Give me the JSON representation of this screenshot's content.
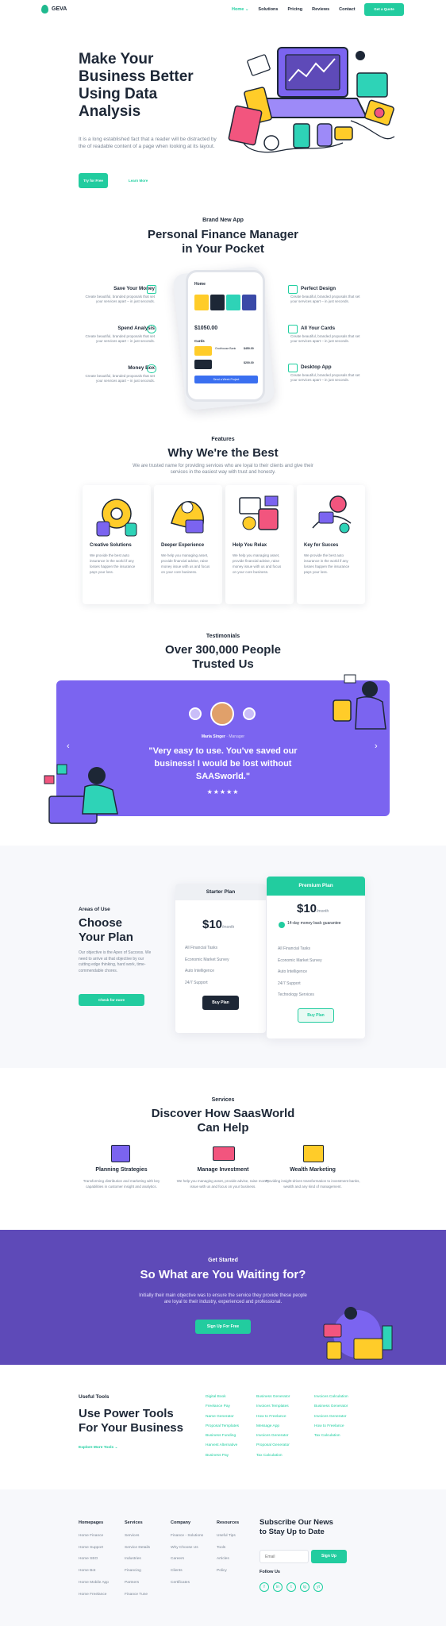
{
  "header": {
    "brand": "GEVA",
    "nav": [
      "Home",
      "Solutions",
      "Pricing",
      "Reviews",
      "Contact"
    ],
    "nav_home_caret": "⌄",
    "quote_button": "Get a Quote"
  },
  "hero": {
    "title_lines": [
      "Make Your",
      "Business Better",
      "Using Data",
      "Analysis"
    ],
    "text": "It is a long established fact that a reader will be distracted by the of readable content of a page when looking at its layout.",
    "primary_button": "Try for Free",
    "secondary_link": "Learn More"
  },
  "app": {
    "kicker": "Brand New App",
    "title_lines": [
      "Personal Finance Manager",
      "in Your Pocket"
    ],
    "left_features": [
      {
        "title": "Save Your Money",
        "text": "Create beautiful, branded proposals that set your services apart – in just seconds.",
        "icon": "wallet-icon"
      },
      {
        "title": "Spend Analysis",
        "text": "Create beautiful, branded proposals that set your services apart – in just seconds.",
        "icon": "chart-pie-icon"
      },
      {
        "title": "Money Box",
        "text": "Create beautiful, branded proposals that set your services apart – in just seconds.",
        "icon": "piggy-bank-icon"
      }
    ],
    "right_features": [
      {
        "title": "Perfect Design",
        "text": "Create beautiful, branded proposals that set your services apart – in just seconds.",
        "icon": "diamond-icon"
      },
      {
        "title": "All Your Cards",
        "text": "Create beautiful, branded proposals that set your services apart – in just seconds.",
        "icon": "credit-card-icon"
      },
      {
        "title": "Desktop App",
        "text": "Create beautiful, branded proposals that set your services apart – in just seconds.",
        "icon": "monitor-icon"
      }
    ],
    "phone": {
      "home": "Home",
      "amount": "$1050.00",
      "cards_label": "Cards",
      "card_name": "Grubhouse Bank",
      "card_amount": "$450.00",
      "card_amount_2": "$200.00",
      "button": "Send a Week Project"
    }
  },
  "features": {
    "kicker": "Features",
    "title": "Why We're the Best",
    "subtitle": "We are trusted name for providing services who are loyal to their clients and give their services in the easiest way with trust and honesty.",
    "cards": [
      {
        "title": "Creative Solutions",
        "text": "We provide the best auto insurance in the world if any losses happen the insurance pays your loss."
      },
      {
        "title": "Deeper Experience",
        "text": "We help you managing asset, provide financial advise, raise money issue with us and focus on your core business."
      },
      {
        "title": "Help You Relax",
        "text": "We help you managing asset, provide financial advise, raise money issue with us and focus on your core business."
      },
      {
        "title": "Key for Succes",
        "text": "We provide the best auto insurance in the world if any losses happen the insurance pays your loss."
      }
    ]
  },
  "testimonials": {
    "kicker": "Testimonials",
    "title_lines": [
      "Over 300,000 People",
      "Trusted Us"
    ],
    "author": "Maria Singer",
    "role": "· Manager",
    "quote": "\"Very easy to use. You've saved our business! I would be lost without SAASworld.\"",
    "rating": 5,
    "stars": "★★★★★",
    "prev_arrow": "‹",
    "next_arrow": "›"
  },
  "pricing": {
    "kicker": "Areas of Use",
    "title_lines": [
      "Choose",
      "Your Plan"
    ],
    "text": "Our objective is the Apex of Success. We need to arrive at that objective by our cutting edge thinking, hard work, time-commendable chores.",
    "button": "Check for more",
    "starter": {
      "name": "Starter Plan",
      "price": "$10",
      "period": "/month",
      "features": [
        "All Financial Tasks",
        "Economic Market Survey",
        "Auto Intelligence",
        "24/7 Support"
      ],
      "button": "Buy Plan"
    },
    "premium": {
      "name": "Premium Plan",
      "price": "$10",
      "period": "/month",
      "trial": "14-day money back guarantee",
      "features": [
        "All Financial Tasks",
        "Economic Market Survey",
        "Auto Intelligence",
        "24/7 Support",
        "Technology Services"
      ],
      "button": "Buy Plan"
    }
  },
  "services": {
    "kicker": "Services",
    "title_lines": [
      "Discover How SaasWorld",
      "Can Help"
    ],
    "items": [
      {
        "title": "Planning Strategies",
        "text": "Transforming distribution and marketing with key capabilities in customer insight and analytics."
      },
      {
        "title": "Manage Investment",
        "text": "We help you managing asset, provide advise, raise money issue with us and focus on your business."
      },
      {
        "title": "Wealth Marketing",
        "text": "Providing insight-driven transformation to investment banks, wealth and any kind of management."
      }
    ]
  },
  "cta": {
    "kicker": "Get Started",
    "title": "So What are You Waiting for?",
    "text": "Initially their main objective was to ensure the service they provide these people are loyal to their industry, experienced and professional.",
    "button": "Sign Up For Free"
  },
  "tools": {
    "kicker": "Useful Tools",
    "title_lines": [
      "Use Power Tools",
      "For Your Business"
    ],
    "link": "Explore More Tools",
    "columns": [
      [
        "Digital Book",
        "Freelance Pay",
        "Name Generator",
        "Proposal Templates",
        "Business Funding",
        "Harvest Alternative",
        "Business Pay"
      ],
      [
        "Business Generator",
        "Invoices Templates",
        "How to Freelance",
        "Message App",
        "Invoices Generator",
        "Proposal Generator",
        "Tax Calculation"
      ],
      [
        "Invoices Calculation",
        "Business Generator",
        "Invoices Generator",
        "How to Freelance",
        "Tax Calculation"
      ]
    ]
  },
  "footer": {
    "columns": [
      {
        "title": "Homepages",
        "items": [
          "Home Finance",
          "Home Support",
          "Home SEO",
          "Home Bot",
          "Home Mobile App",
          "Home Freelance"
        ]
      },
      {
        "title": "Services",
        "items": [
          "Services",
          "Service Details",
          "Industries",
          "Financing",
          "Partners",
          "Finance Tune"
        ]
      },
      {
        "title": "Company",
        "items": [
          "Finance - Solutions",
          "Why Choose Us",
          "Careers",
          "Clients",
          "Certificates"
        ]
      },
      {
        "title": "Resources",
        "items": [
          "Useful Tips",
          "Tools",
          "Articles",
          "Policy"
        ]
      }
    ],
    "newsletter_title_lines": [
      "Subscribe Our News",
      "to Stay Up to Date"
    ],
    "email_placeholder": "Email",
    "signup_button": "Sign Up",
    "follow": "Follow Us",
    "socials": [
      "f",
      "in",
      "t",
      "ig",
      "yt"
    ],
    "social_icons": [
      "facebook-icon",
      "linkedin-icon",
      "twitter-icon",
      "instagram-icon",
      "youtube-icon"
    ]
  },
  "colors": {
    "accent": "#22cc9f",
    "purple": "#7b64f0",
    "cta_bg": "#5e4ab8",
    "text": "#1d2736"
  }
}
